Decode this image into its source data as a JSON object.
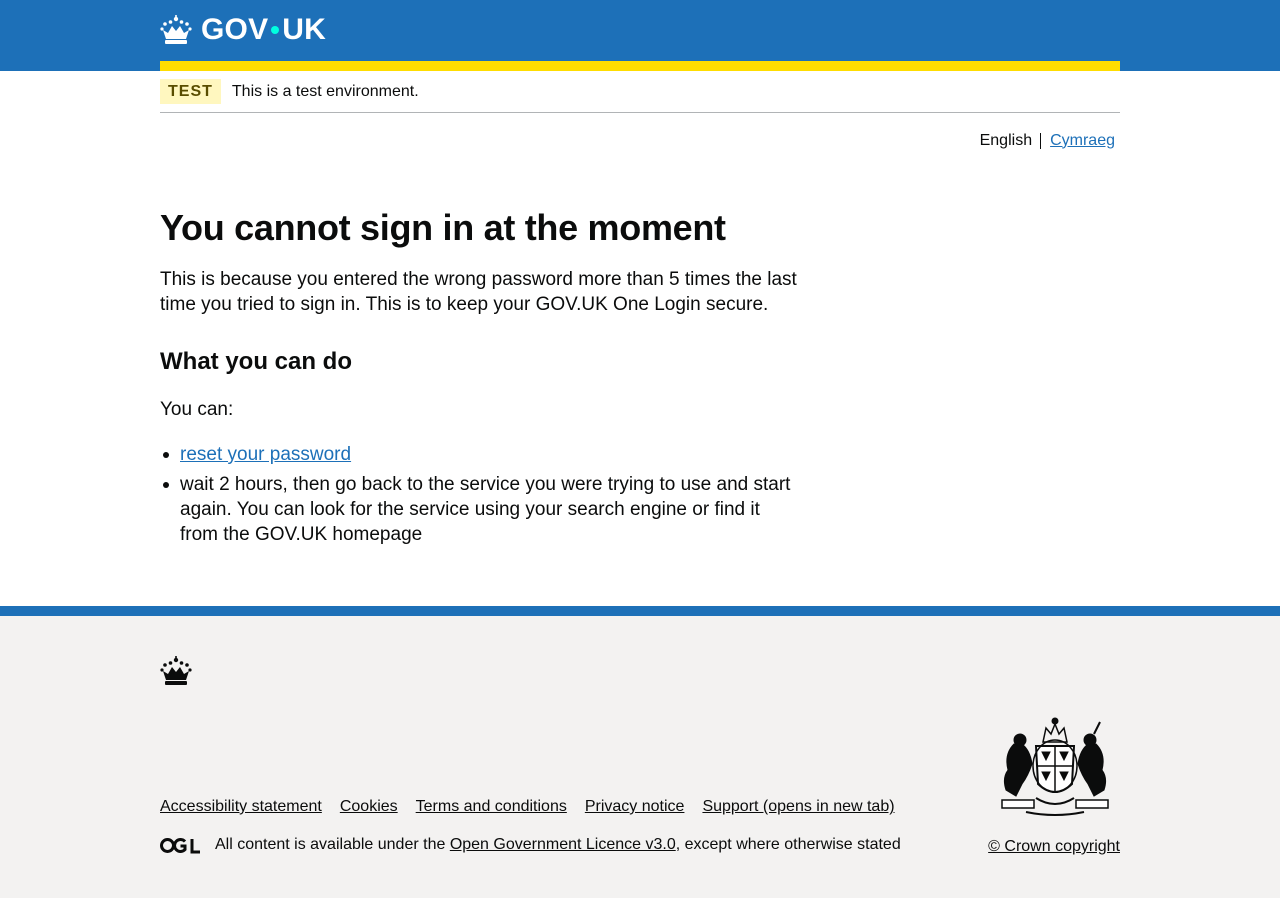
{
  "header": {
    "logo_text": "GOV",
    "logo_text_suffix": "UK"
  },
  "phase_banner": {
    "tag": "TEST",
    "text": "This is a test environment."
  },
  "language": {
    "current": "English",
    "alternate": "Cymraeg"
  },
  "main": {
    "title": "You cannot sign in at the moment",
    "intro": "This is because you entered the wrong password more than 5 times the last time you tried to sign in. This is to keep your GOV.UK One Login secure.",
    "heading": "What you can do",
    "you_can": "You can:",
    "items": [
      {
        "link": "reset your password"
      },
      {
        "text": "wait 2 hours, then go back to the service you were trying to use and start again. You can look for the service using your search engine or find it from the GOV.UK homepage"
      }
    ]
  },
  "footer": {
    "links": [
      "Accessibility statement",
      "Cookies",
      "Terms and conditions",
      "Privacy notice",
      "Support (opens in new tab)"
    ],
    "licence_prefix": "All content is available under the ",
    "licence_link": "Open Government Licence v3.0",
    "licence_suffix": ", except where otherwise stated",
    "copyright": "© Crown copyright"
  },
  "colors": {
    "brand_blue": "#1d70b8",
    "stripe_yellow": "#ffdd00",
    "tag_bg": "#fff7bf",
    "footer_bg": "#f3f2f1"
  }
}
